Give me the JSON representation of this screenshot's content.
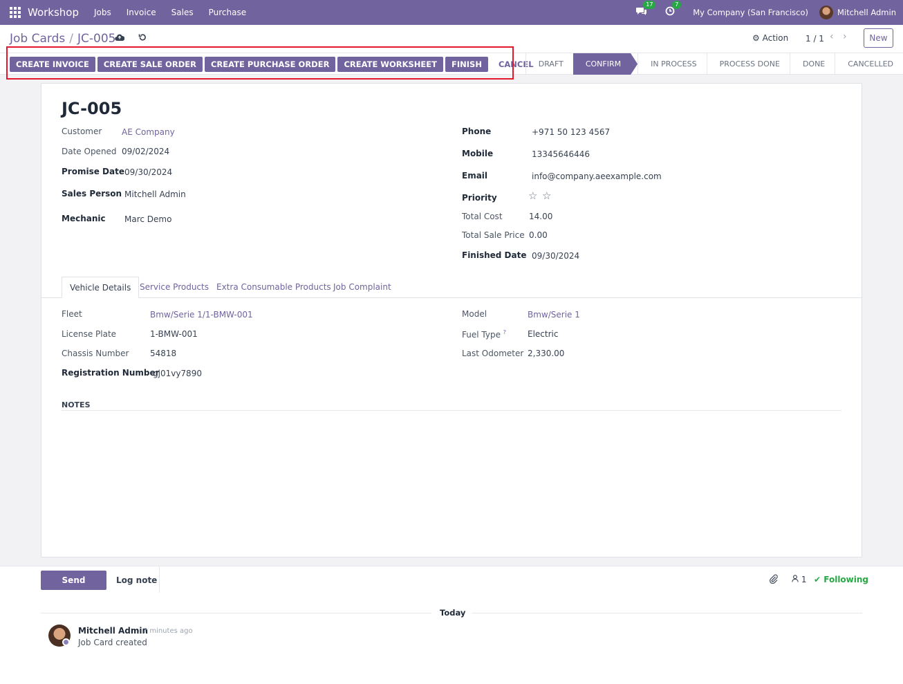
{
  "navbar": {
    "brand": "Workshop",
    "menu": [
      "Jobs",
      "Invoice",
      "Sales",
      "Purchase"
    ],
    "messages_count": "17",
    "activities_count": "7",
    "company": "My Company (San Francisco)",
    "user": "Mitchell Admin"
  },
  "control_panel": {
    "breadcrumb_parent": "Job Cards",
    "breadcrumb_current": "JC-005",
    "action_label": "Action",
    "pager": "1 / 1",
    "new_label": "New"
  },
  "header_buttons": {
    "create_invoice": "CREATE INVOICE",
    "create_sale_order": "CREATE SALE ORDER",
    "create_purchase_order": "CREATE PURCHASE ORDER",
    "create_worksheet": "CREATE WORKSHEET",
    "finish": "FINISH",
    "cancel": "CANCEL"
  },
  "stages": {
    "draft": "DRAFT",
    "confirm": "CONFIRM",
    "in_process": "IN PROCESS",
    "process_done": "PROCESS DONE",
    "done": "DONE",
    "cancelled": "CANCELLED",
    "active": "CONFIRM"
  },
  "form": {
    "title": "JC-005",
    "left": {
      "customer_label": "Customer",
      "customer": "AE Company",
      "date_opened_label": "Date Opened",
      "date_opened": "09/02/2024",
      "promise_date_label": "Promise Date",
      "promise_date": "09/30/2024",
      "sales_person_label": "Sales Person",
      "sales_person": "Mitchell Admin",
      "mechanic_label": "Mechanic",
      "mechanic": "Marc Demo"
    },
    "right": {
      "phone_label": "Phone",
      "phone": "+971 50 123 4567",
      "mobile_label": "Mobile",
      "mobile": "13345646446",
      "email_label": "Email",
      "email": "info@company.aeexample.com",
      "priority_label": "Priority",
      "priority_stars": 0,
      "total_cost_label": "Total Cost",
      "total_cost": "14.00",
      "total_sale_price_label": "Total Sale Price",
      "total_sale_price": "0.00",
      "finished_date_label": "Finished Date",
      "finished_date": "09/30/2024"
    },
    "tabs": {
      "vehicle_details": "Vehicle Details",
      "service_products": "Service Products",
      "extra_consumable": "Extra Consumable Products",
      "job_complaint": "Job Complaint"
    },
    "vehicle": {
      "fleet_label": "Fleet",
      "fleet": "Bmw/Serie 1/1-BMW-001",
      "license_plate_label": "License Plate",
      "license_plate": "1-BMW-001",
      "chassis_label": "Chassis Number",
      "chassis": "54818",
      "registration_label": "Registration Number",
      "registration": "gj01vy7890",
      "model_label": "Model",
      "model": "Bmw/Serie 1",
      "fuel_type_label": "Fuel Type",
      "fuel_type_help": "?",
      "fuel_type": "Electric",
      "last_odometer_label": "Last Odometer",
      "last_odometer": "2,330.00"
    },
    "notes_label": "NOTES"
  },
  "chatter": {
    "send_message": "Send message",
    "log_note": "Log note",
    "followers_count": "1",
    "following": "Following",
    "date_separator": "Today",
    "message": {
      "author": "Mitchell Admin",
      "time": "- 7 minutes ago",
      "body": "Job Card created"
    }
  },
  "colors": {
    "brand": "#71639e",
    "success": "#28a745",
    "highlight": "#e3182d"
  }
}
